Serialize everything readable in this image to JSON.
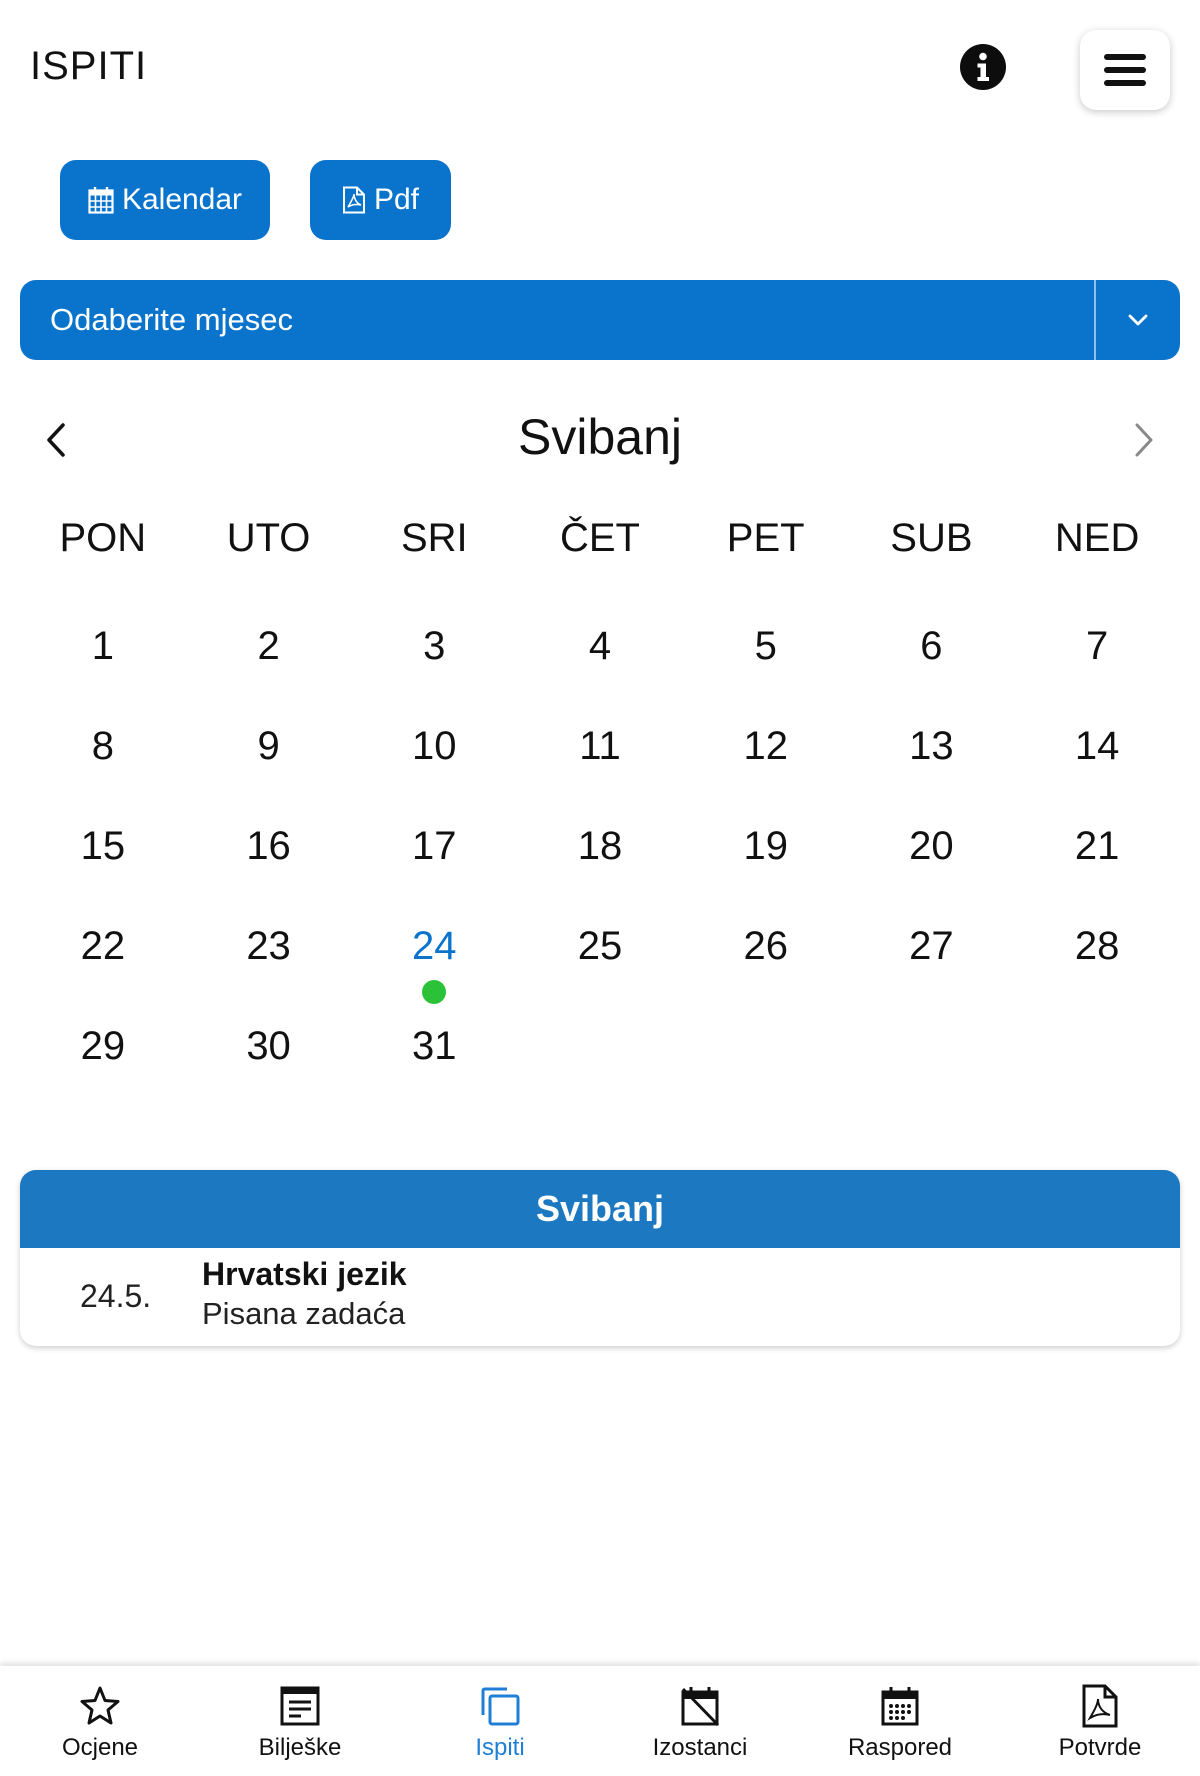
{
  "header": {
    "title": "ISPITI",
    "info_icon": "info-icon",
    "menu_icon": "hamburger-menu-icon"
  },
  "actions": {
    "kalendar_label": "Kalendar",
    "pdf_label": "Pdf"
  },
  "month_select": {
    "placeholder": "Odaberite mjesec"
  },
  "calendar": {
    "month": "Svibanj",
    "weekdays": [
      "PON",
      "UTO",
      "SRI",
      "ČET",
      "PET",
      "SUB",
      "NED"
    ],
    "days": [
      "1",
      "2",
      "3",
      "4",
      "5",
      "6",
      "7",
      "8",
      "9",
      "10",
      "11",
      "12",
      "13",
      "14",
      "15",
      "16",
      "17",
      "18",
      "19",
      "20",
      "21",
      "22",
      "23",
      "24",
      "25",
      "26",
      "27",
      "28",
      "29",
      "30",
      "31"
    ],
    "highlighted_day": "24",
    "event_day": "24"
  },
  "exams": {
    "title": "Svibanj",
    "items": [
      {
        "date": "24.5.",
        "subject": "Hrvatski jezik",
        "type": "Pisana zadaća"
      }
    ]
  },
  "bottom_nav": {
    "items": [
      {
        "label": "Ocjene",
        "icon": "star-icon"
      },
      {
        "label": "Bilješke",
        "icon": "notes-icon"
      },
      {
        "label": "Ispiti",
        "icon": "copy-icon"
      },
      {
        "label": "Izostanci",
        "icon": "calendar-off-icon"
      },
      {
        "label": "Raspored",
        "icon": "calendar-grid-icon"
      },
      {
        "label": "Potvrde",
        "icon": "pdf-file-icon"
      }
    ],
    "active": "Ispiti"
  },
  "colors": {
    "primary": "#0a74cc",
    "header_bar": "#1c78c0",
    "event_dot": "#2bc23a",
    "active_nav": "#1f7fd6"
  }
}
